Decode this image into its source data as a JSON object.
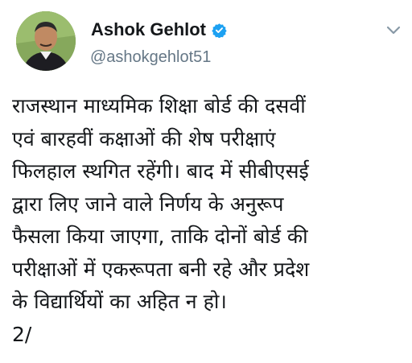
{
  "tweet": {
    "author_name": "Ashok Gehlot",
    "handle": "@ashokgehlot51",
    "body_lines": [
      "राजस्थान माध्यमिक शिक्षा बोर्ड की दसवीं",
      "एवं बारहवीं कक्षाओं की शेष परीक्षाएं",
      "फिलहाल स्थगित रहेंगी। बाद में सीबीएसई",
      "द्वारा लिए जाने वाले निर्णय के अनुरूप",
      "फैसला किया जाएगा, ताकि दोनों बोर्ड की",
      "परीक्षाओं में एकरूपता बनी रहे और प्रदेश",
      "के विद्यार्थियों का अहित न हो।",
      "2/"
    ],
    "verified": true,
    "icons": {
      "verified": "verified-badge-icon",
      "menu": "chevron-down-icon",
      "avatar": "profile-photo"
    },
    "colors": {
      "verified_blue": "#1da1f2",
      "name_text": "#14171a",
      "secondary_text": "#657786"
    }
  }
}
